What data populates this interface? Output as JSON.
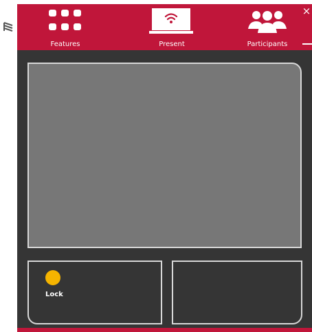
{
  "colors": {
    "brand": "#c0163a",
    "panel_bg": "#353535",
    "preview_bg": "#777777",
    "outline": "#d8d8d8",
    "lock_indicator": "#f5b400",
    "text": "#ffffff"
  },
  "logo": {
    "icon": "vertical-logo-icon"
  },
  "nav": {
    "features": {
      "label": "Features",
      "icon": "grid-icon"
    },
    "present": {
      "label": "Present",
      "icon": "screen-wifi-icon"
    },
    "participants": {
      "label": "Participants",
      "icon": "people-icon"
    }
  },
  "window": {
    "close_glyph": "×",
    "close_icon": "close-icon",
    "minimize_icon": "minimize-icon"
  },
  "lock": {
    "label": "Lock",
    "icon": "status-dot-icon"
  }
}
